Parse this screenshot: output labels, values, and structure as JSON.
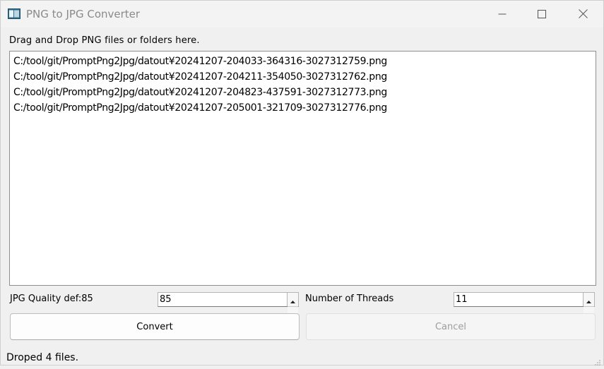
{
  "window": {
    "title": "PNG to JPG Converter"
  },
  "drop_label": "Drag and Drop PNG files or folders here.",
  "file_list": [
    "C:/tool/git/PromptPng2Jpg/datout¥20241207-204033-364316-3027312759.png",
    "C:/tool/git/PromptPng2Jpg/datout¥20241207-204211-354050-3027312762.png",
    "C:/tool/git/PromptPng2Jpg/datout¥20241207-204823-437591-3027312773.png",
    "C:/tool/git/PromptPng2Jpg/datout¥20241207-205001-321709-3027312776.png"
  ],
  "quality": {
    "label": "JPG Quality def:85",
    "value": "85"
  },
  "threads": {
    "label": "Number of Threads",
    "value": "11"
  },
  "buttons": {
    "convert": "Convert",
    "cancel": "Cancel"
  },
  "status": "Droped 4 files.",
  "icons": {
    "app": "app-window-icon",
    "minimize": "minimize-icon",
    "maximize": "maximize-icon",
    "close": "close-icon",
    "spin_up": "chevron-up-icon",
    "spin_down": "chevron-down-icon",
    "resize": "resize-grip-icon"
  },
  "colors": {
    "background": "#f0f0f0",
    "title_text": "#8a8a8a",
    "disabled_text": "#9d9d9d"
  }
}
